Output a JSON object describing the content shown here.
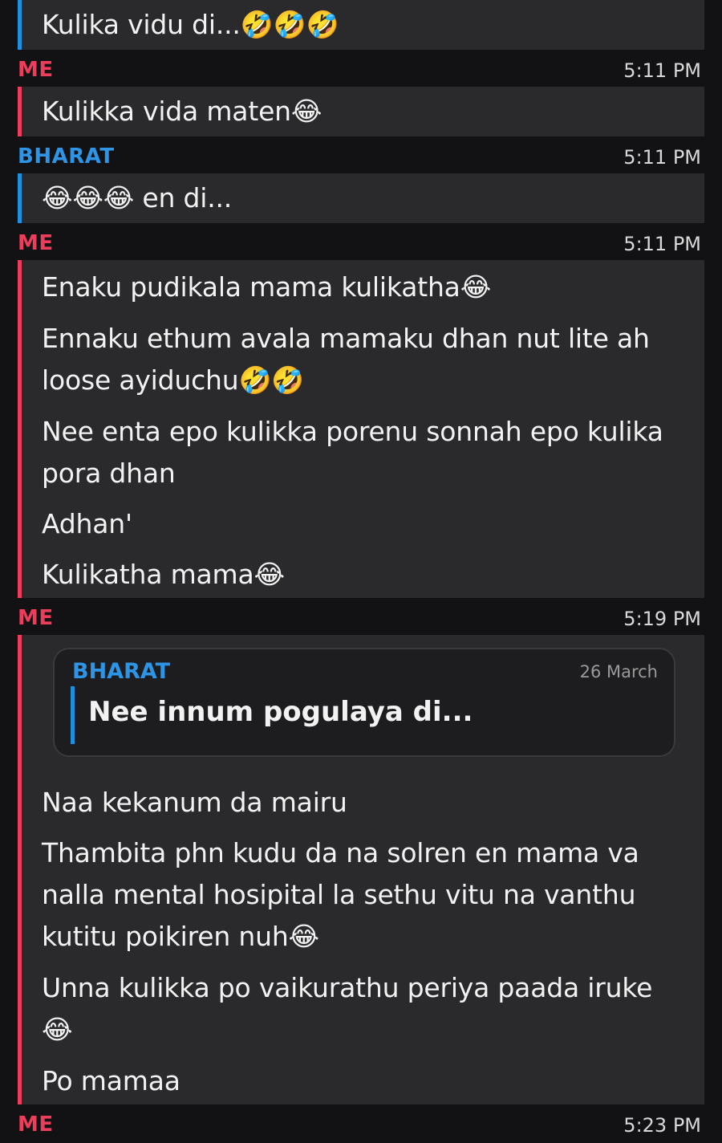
{
  "messages": [
    {
      "sender": "",
      "lines": [
        "Kulika vidu di...🤣🤣🤣"
      ]
    },
    {
      "sender": "ME",
      "time": "5:11 PM",
      "lines": [
        "Kulikka vida maten😂"
      ]
    },
    {
      "sender": "BHARAT",
      "time": "5:11 PM",
      "lines": [
        "😂😂😂 en di..."
      ]
    },
    {
      "sender": "ME",
      "time": "5:11 PM",
      "lines": [
        "Enaku pudikala mama kulikatha😂",
        "Ennaku ethum avala mamaku dhan nut lite ah",
        "loose ayiduchu🤣🤣",
        "Nee enta epo kulikka porenu sonnah epo kulika",
        "pora dhan",
        "Adhan'",
        "Kulikatha mama😂"
      ]
    },
    {
      "sender": "ME",
      "time": "5:19 PM",
      "quote": {
        "sender": "BHARAT",
        "date": "26 March",
        "text": "Nee innum pogulaya di..."
      },
      "lines": [
        "Naa kekanum da mairu",
        "Thambita phn kudu da na solren en mama va",
        "nalla mental hosipital la sethu vitu na vanthu",
        "kutitu poikiren nuh😂",
        "Unna kulikka po vaikurathu periya paada iruke",
        "😂",
        "Po mamaa"
      ]
    },
    {
      "sender": "ME",
      "time": "5:23 PM",
      "lines": []
    }
  ],
  "colors": {
    "background": "#121214",
    "bubble": "#2a2a2c",
    "me_accent": "#ee3c5b",
    "bharat_accent": "#1f8fe1"
  }
}
